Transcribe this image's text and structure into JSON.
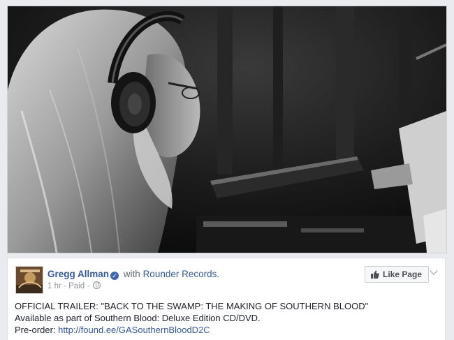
{
  "post": {
    "author": "Gregg Allman",
    "with_text": "with",
    "partner": "Rounder Records.",
    "time": "1 hr",
    "separator": "·",
    "paid": "Paid",
    "like_page_label": "Like Page",
    "lines": {
      "line1": "OFFICIAL TRAILER: \"BACK TO THE SWAMP: THE MAKING OF SOUTHERN BLOOD\"",
      "line2": "Available as part of Southern Blood: Deluxe Edition CD/DVD.",
      "preorder_label": "Pre-order:",
      "preorder_link": "http://found.ee/GASouthernBloodD2C"
    }
  },
  "icons": {
    "verified": "verified-check-icon",
    "globe": "globe-icon",
    "like": "thumbs-up-icon",
    "menu": "chevron-down-icon"
  },
  "colors": {
    "link": "#365899",
    "meta": "#90949c",
    "verified": "#4267b2",
    "page_bg": "#e9ebee"
  }
}
